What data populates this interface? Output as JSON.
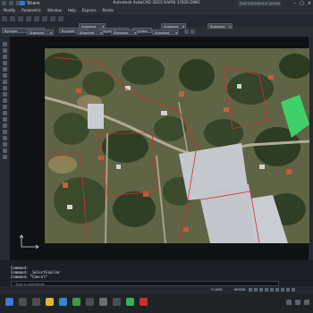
{
  "app": {
    "title": "Autodesk AutoCAD 2023  KARSI 1/500.DWG",
    "share_label": "Share",
    "search_placeholder": "Type a keyword or phrase"
  },
  "menu": [
    "Modify",
    "Parametric",
    "Window",
    "Help",
    "Express",
    "Raster"
  ],
  "propbar": {
    "row1": {
      "layer": "ByLayer",
      "linetype": "ByLayer",
      "lineweight": "ByLayer",
      "plotstyle": "ByColor",
      "standard1": "Standard",
      "standard2": "Standard",
      "standard3": "Standard"
    },
    "row2": {
      "style1": "Standard",
      "style2": "Standard",
      "style3": "Standard",
      "style4": "Standard"
    }
  },
  "command": {
    "lines": [
      "Command:",
      "Command:  _SelectSimilar",
      "Command: *Cancel*"
    ],
    "input_placeholder": "Type a command"
  },
  "status": {
    "coords": "0.0000",
    "model": "MODEL"
  }
}
